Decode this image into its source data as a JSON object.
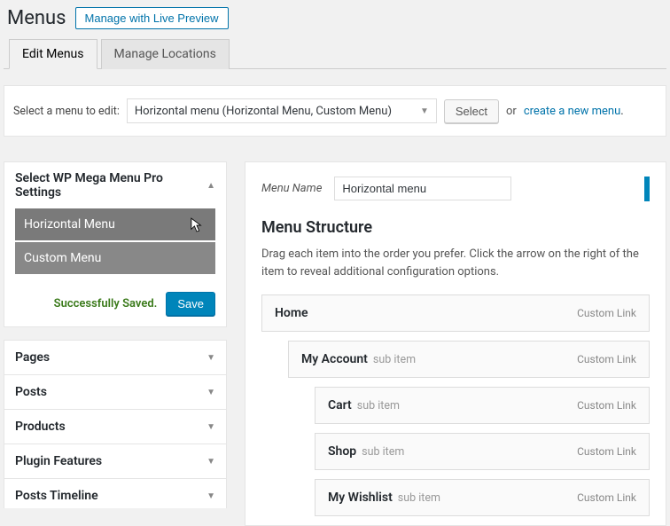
{
  "header": {
    "title": "Menus",
    "live_preview_button": "Manage with Live Preview"
  },
  "tabs": {
    "edit": "Edit Menus",
    "locations": "Manage Locations"
  },
  "select_bar": {
    "label": "Select a menu to edit:",
    "dropdown_value": "Horizontal menu (Horizontal Menu, Custom Menu)",
    "select_button": "Select",
    "or_text": "or",
    "create_link": "create a new menu",
    "period": "."
  },
  "mega_panel": {
    "title": "Select WP Mega Menu Pro Settings",
    "items": [
      "Horizontal Menu",
      "Custom Menu"
    ],
    "saved_msg": "Successfully Saved.",
    "save_button": "Save"
  },
  "accordion": {
    "items": [
      "Pages",
      "Posts",
      "Products",
      "Plugin Features",
      "Posts Timeline"
    ]
  },
  "menu_form": {
    "name_label": "Menu Name",
    "name_value": "Horizontal menu"
  },
  "menu_structure": {
    "title": "Menu Structure",
    "desc": "Drag each item into the order you prefer. Click the arrow on the right of the item to reveal additional configuration options.",
    "items": [
      {
        "title": "Home",
        "sub": "",
        "type": "Custom Link",
        "indent": 0
      },
      {
        "title": "My Account",
        "sub": "sub item",
        "type": "Custom Link",
        "indent": 1
      },
      {
        "title": "Cart",
        "sub": "sub item",
        "type": "Custom Link",
        "indent": 2
      },
      {
        "title": "Shop",
        "sub": "sub item",
        "type": "Custom Link",
        "indent": 2
      },
      {
        "title": "My Wishlist",
        "sub": "sub item",
        "type": "Custom Link",
        "indent": 2
      }
    ]
  }
}
